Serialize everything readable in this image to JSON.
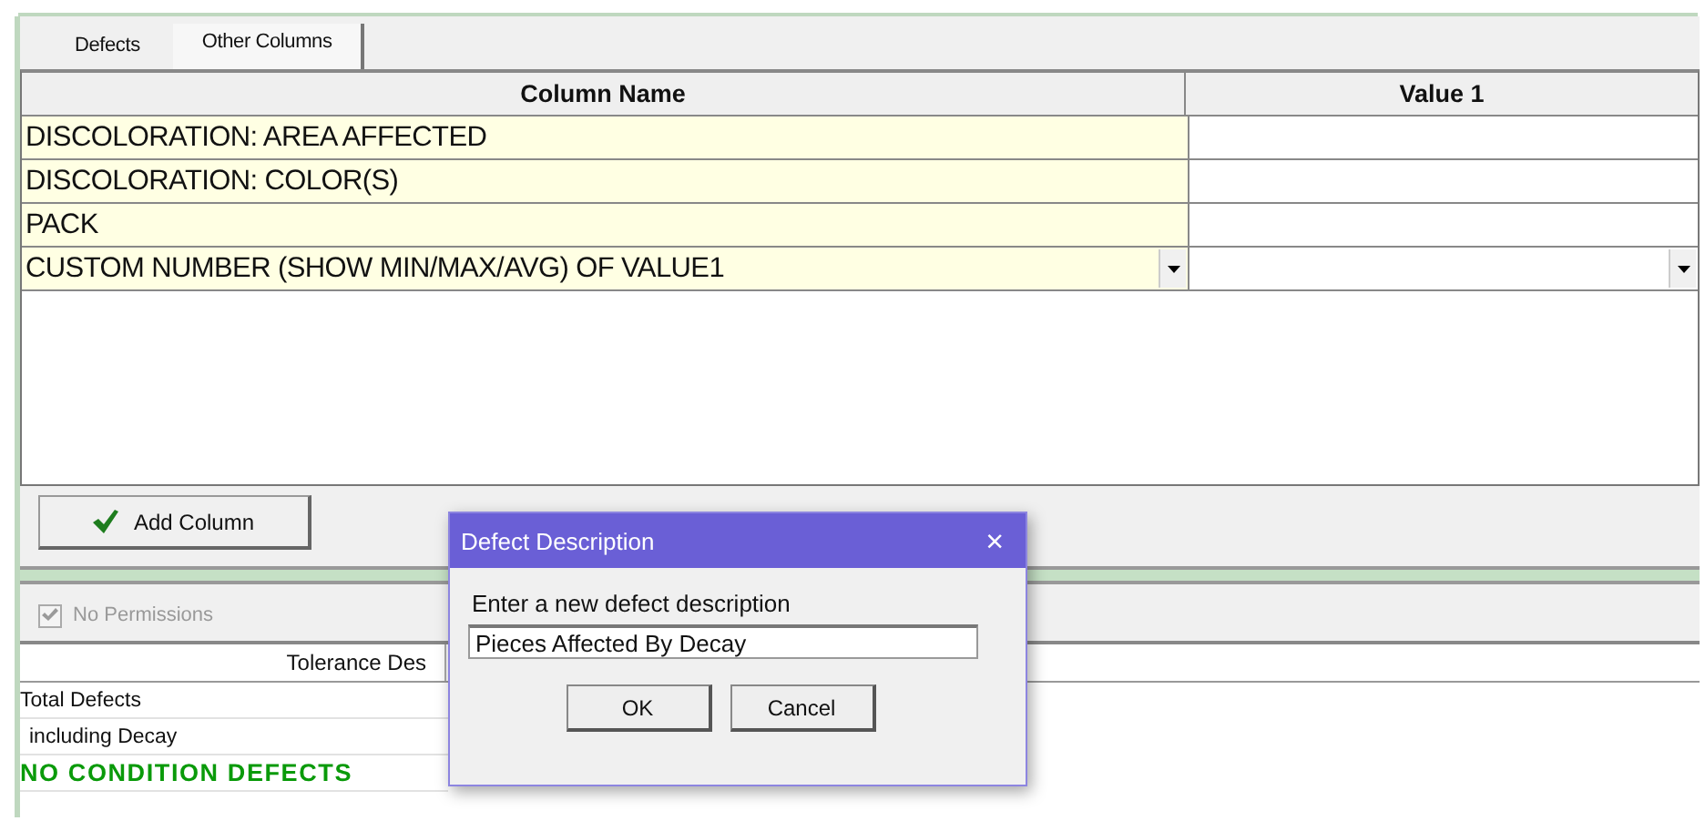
{
  "tabs": [
    {
      "label": "Defects",
      "selected": false
    },
    {
      "label": "Other Columns",
      "selected": true
    }
  ],
  "columns_grid": {
    "columns": [
      "Column Name",
      "Value 1"
    ],
    "rows": [
      {
        "name": "DISCOLORATION: AREA AFFECTED",
        "dropdown": false
      },
      {
        "name": "DISCOLORATION: COLOR(S)",
        "dropdown": false
      },
      {
        "name": "PACK",
        "dropdown": false
      },
      {
        "name": "CUSTOM NUMBER (SHOW MIN/MAX/AVG) OF VALUE1",
        "dropdown": true
      }
    ]
  },
  "add_button": {
    "label": "Add Column"
  },
  "permissions": {
    "label": "No Permissions",
    "checked": true,
    "disabled": true
  },
  "tolerance_grid": {
    "header": "Tolerance Des",
    "rows": [
      {
        "label": "Total Defects",
        "kind": "normal",
        "children": [
          {
            "label": "including Decay",
            "kind": "normal"
          }
        ]
      },
      {
        "label": "NO CONDITION DEFECTS",
        "kind": "status"
      }
    ]
  },
  "dialog": {
    "title": "Defect Description",
    "close": "×",
    "prompt": "Enter a new defect description",
    "value": "Pieces Affected By Decay",
    "buttons": [
      "OK",
      "Cancel"
    ]
  }
}
